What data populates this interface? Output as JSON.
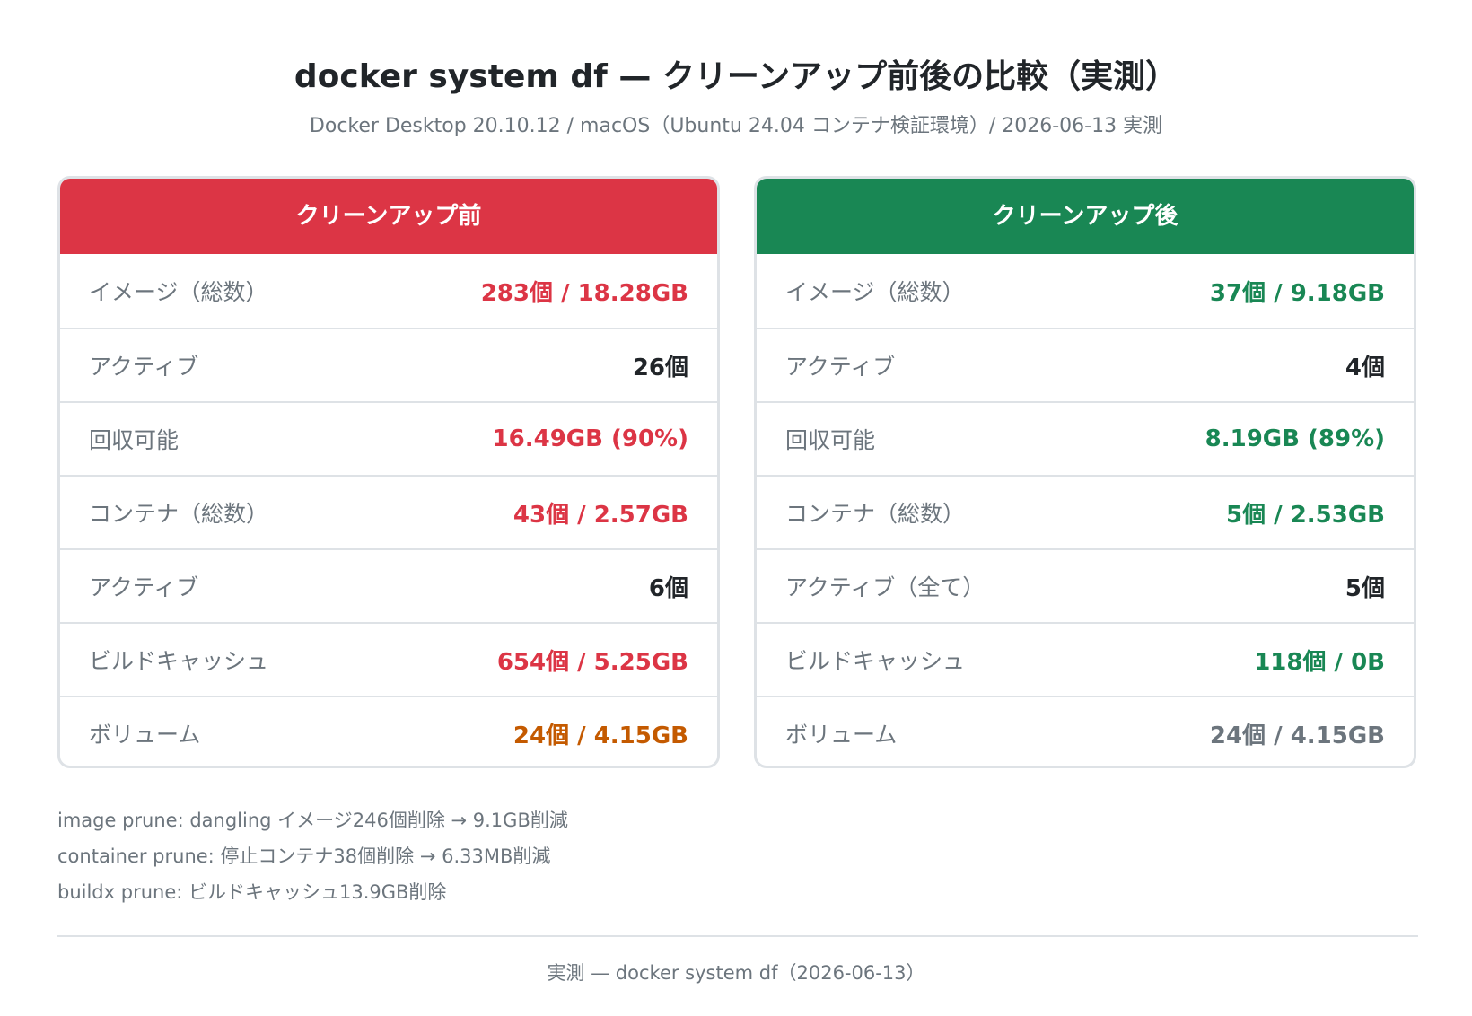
{
  "header": {
    "title": "docker system df — クリーンアップ前後の比較（実測）",
    "subtitle": "Docker Desktop 20.10.12 / macOS（Ubuntu 24.04 コンテナ検証環境）/ 2026-06-13 実測"
  },
  "before": {
    "title": "クリーンアップ前",
    "rows": [
      {
        "label": "イメージ（総数）",
        "value": "283個 / 18.28GB"
      },
      {
        "label": "アクティブ",
        "value": "26個"
      },
      {
        "label": "回収可能",
        "value": "16.49GB (90%)"
      },
      {
        "label": "コンテナ（総数）",
        "value": "43個 / 2.57GB"
      },
      {
        "label": "アクティブ",
        "value": "6個"
      },
      {
        "label": "ビルドキャッシュ",
        "value": "654個 / 5.25GB"
      },
      {
        "label": "ボリューム",
        "value": "24個 / 4.15GB"
      }
    ]
  },
  "after": {
    "title": "クリーンアップ後",
    "rows": [
      {
        "label": "イメージ（総数）",
        "value": "37個 / 9.18GB"
      },
      {
        "label": "アクティブ",
        "value": "4個"
      },
      {
        "label": "回収可能",
        "value": "8.19GB (89%)"
      },
      {
        "label": "コンテナ（総数）",
        "value": "5個 / 2.53GB"
      },
      {
        "label": "アクティブ（全て）",
        "value": "5個"
      },
      {
        "label": "ビルドキャッシュ",
        "value": "118個 / 0B"
      },
      {
        "label": "ボリューム",
        "value": "24個 / 4.15GB"
      }
    ]
  },
  "colors": {
    "before_header": "#dc3545",
    "after_header": "#198754",
    "highlight_red": "#dc3545",
    "highlight_green": "#198754",
    "volume_orange": "#c45a00"
  },
  "notes": [
    "image prune: dangling イメージ246個削除 → 9.1GB削減",
    "container prune: 停止コンテナ38個削除 → 6.33MB削減",
    "buildx prune: ビルドキャッシュ13.9GB削除"
  ],
  "footer": "実測 — docker system df（2026-06-13）"
}
